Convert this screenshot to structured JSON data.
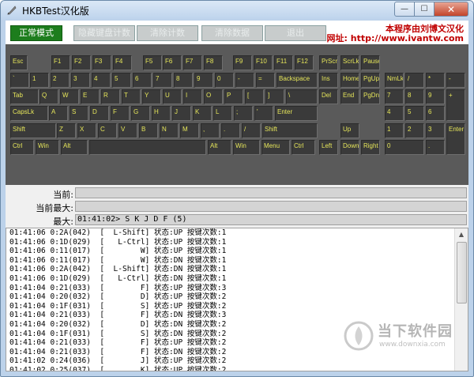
{
  "window": {
    "title": "HKBTest汉化版",
    "close_glyph": "✕",
    "min_glyph": "—",
    "max_glyph": "☐"
  },
  "toolbar": {
    "buttons": [
      {
        "label": "正常模式",
        "active": true
      },
      {
        "label": "隐藏键盘计数",
        "active": false
      },
      {
        "label": "清除计数",
        "active": false
      },
      {
        "label": "清除数据",
        "active": false
      },
      {
        "label": "退出",
        "active": false
      }
    ],
    "credit_line1": "本程序由刘博文汉化",
    "credit_line2": "网址: http://www.ivantw.com"
  },
  "keyboard": {
    "rows": [
      [
        "Esc",
        "F1",
        "F2",
        "F3",
        "F4",
        "F5",
        "F6",
        "F7",
        "F8",
        "F9",
        "F10",
        "F11",
        "F12",
        "PrScr",
        "ScrLk",
        "Pause"
      ],
      [
        "`",
        "1",
        "2",
        "3",
        "4",
        "5",
        "6",
        "7",
        "8",
        "9",
        "0",
        "-",
        "=",
        "Backspace",
        "Ins",
        "Home",
        "PgUp",
        "NmLk",
        "/",
        "*",
        "-"
      ],
      [
        "Tab",
        "Q",
        "W",
        "E",
        "R",
        "T",
        "Y",
        "U",
        "I",
        "O",
        "P",
        "[",
        "]",
        "\\",
        "Del",
        "End",
        "PgDn",
        "7",
        "8",
        "9",
        "+"
      ],
      [
        "CapsLk",
        "A",
        "S",
        "D",
        "F",
        "G",
        "H",
        "J",
        "K",
        "L",
        ";",
        "'",
        "Enter",
        "4",
        "5",
        "6"
      ],
      [
        "Shift",
        "Z",
        "X",
        "C",
        "V",
        "B",
        "N",
        "M",
        ",",
        ".",
        "/",
        "Shift",
        "Up",
        "1",
        "2",
        "3",
        "Enter"
      ],
      [
        "Ctrl",
        "Win",
        "Alt",
        "",
        "Alt",
        "Win",
        "Menu",
        "Ctrl",
        "Left",
        "Down",
        "Right",
        "0",
        "."
      ]
    ]
  },
  "info": {
    "current_label": "当前:",
    "current_value": "",
    "current_max_label": "当前最大:",
    "current_max_value": "",
    "max_label": "最大:",
    "max_value": "01:41:02> S K J D F (5)"
  },
  "log": [
    "01:41:06 0:2A(042)  [  L-Shift] 状态:UP 按键次数:1",
    "01:41:06 0:1D(029)  [   L-Ctrl] 状态:UP 按键次数:1",
    "01:41:06 0:11(017)  [        W] 状态:UP 按键次数:1",
    "01:41:06 0:11(017)  [        W] 状态:DN 按键次数:1",
    "01:41:06 0:2A(042)  [  L-Shift] 状态:DN 按键次数:1",
    "01:41:06 0:1D(029)  [   L-Ctrl] 状态:DN 按键次数:1",
    "01:41:04 0:21(033)  [        F] 状态:UP 按键次数:3",
    "01:41:04 0:20(032)  [        D] 状态:UP 按键次数:2",
    "01:41:04 0:1F(031)  [        S] 状态:UP 按键次数:2",
    "01:41:04 0:21(033)  [        F] 状态:DN 按键次数:3",
    "01:41:04 0:20(032)  [        D] 状态:DN 按键次数:2",
    "01:41:04 0:1F(031)  [        S] 状态:DN 按键次数:2",
    "01:41:04 0:21(033)  [        F] 状态:UP 按键次数:2",
    "01:41:04 0:21(033)  [        F] 状态:DN 按键次数:2",
    "01:41:02 0:24(036)  [        J] 状态:UP 按键次数:2",
    "01:41:02 0:25(037)  [        K] 状态:UP 按键次数:2"
  ],
  "watermark": {
    "name": "当下软件园",
    "url": "www.downxia.com"
  },
  "colors": {
    "key_text": "#e6e65a",
    "active_button": "#1d7d1d",
    "credit": "#c00000"
  }
}
